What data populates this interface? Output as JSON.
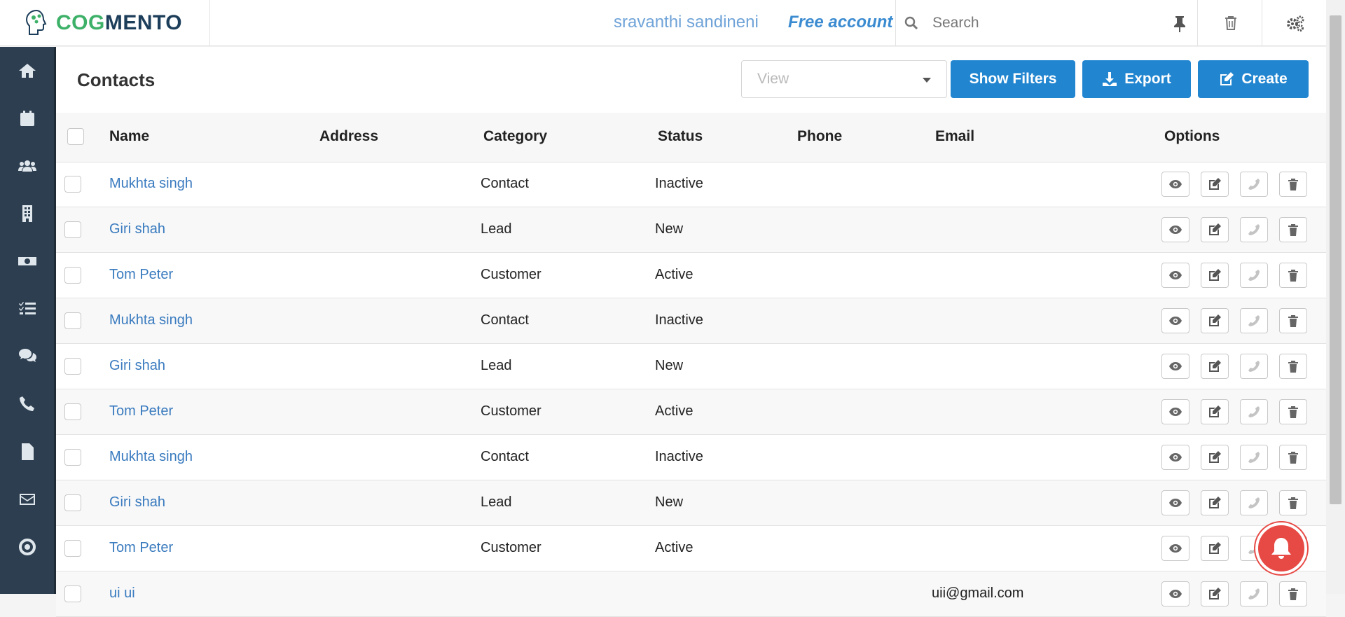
{
  "app": {
    "logo_text_green": "COG",
    "logo_text_dark": "MENTO",
    "user_name": "sravanthi sandineni",
    "account_type": "Free account",
    "search_placeholder": "Search"
  },
  "colors": {
    "primary_button": "#2185d0",
    "sidebar_bg": "#2c3e50",
    "link": "#3a7bbf",
    "notification": "#e74a45"
  },
  "sidebar": {
    "items": [
      {
        "icon": "home-icon"
      },
      {
        "icon": "calendar-icon"
      },
      {
        "icon": "users-icon"
      },
      {
        "icon": "building-icon"
      },
      {
        "icon": "money-icon"
      },
      {
        "icon": "tasks-icon"
      },
      {
        "icon": "comments-icon"
      },
      {
        "icon": "phone-icon"
      },
      {
        "icon": "document-icon"
      },
      {
        "icon": "envelope-icon"
      },
      {
        "icon": "bullseye-icon"
      }
    ]
  },
  "page": {
    "title": "Contacts",
    "view_placeholder": "View",
    "buttons": {
      "show_filters": "Show Filters",
      "export": "Export",
      "create": "Create"
    }
  },
  "table": {
    "columns": [
      "Name",
      "Address",
      "Category",
      "Status",
      "Phone",
      "Email",
      "Options"
    ],
    "rows": [
      {
        "name": "Mukhta singh",
        "address": "",
        "category": "Contact",
        "status": "Inactive",
        "phone": "",
        "email": ""
      },
      {
        "name": "Giri shah",
        "address": "",
        "category": "Lead",
        "status": "New",
        "phone": "",
        "email": ""
      },
      {
        "name": "Tom Peter",
        "address": "",
        "category": "Customer",
        "status": "Active",
        "phone": "",
        "email": ""
      },
      {
        "name": "Mukhta singh",
        "address": "",
        "category": "Contact",
        "status": "Inactive",
        "phone": "",
        "email": ""
      },
      {
        "name": "Giri shah",
        "address": "",
        "category": "Lead",
        "status": "New",
        "phone": "",
        "email": ""
      },
      {
        "name": "Tom Peter",
        "address": "",
        "category": "Customer",
        "status": "Active",
        "phone": "",
        "email": ""
      },
      {
        "name": "Mukhta singh",
        "address": "",
        "category": "Contact",
        "status": "Inactive",
        "phone": "",
        "email": ""
      },
      {
        "name": "Giri shah",
        "address": "",
        "category": "Lead",
        "status": "New",
        "phone": "",
        "email": ""
      },
      {
        "name": "Tom Peter",
        "address": "",
        "category": "Customer",
        "status": "Active",
        "phone": "",
        "email": ""
      },
      {
        "name": "ui ui",
        "address": "",
        "category": "",
        "status": "",
        "phone": "",
        "email": "uii@gmail.com"
      }
    ],
    "option_icons": [
      "eye-icon",
      "edit-icon",
      "phone-icon",
      "trash-icon"
    ]
  }
}
